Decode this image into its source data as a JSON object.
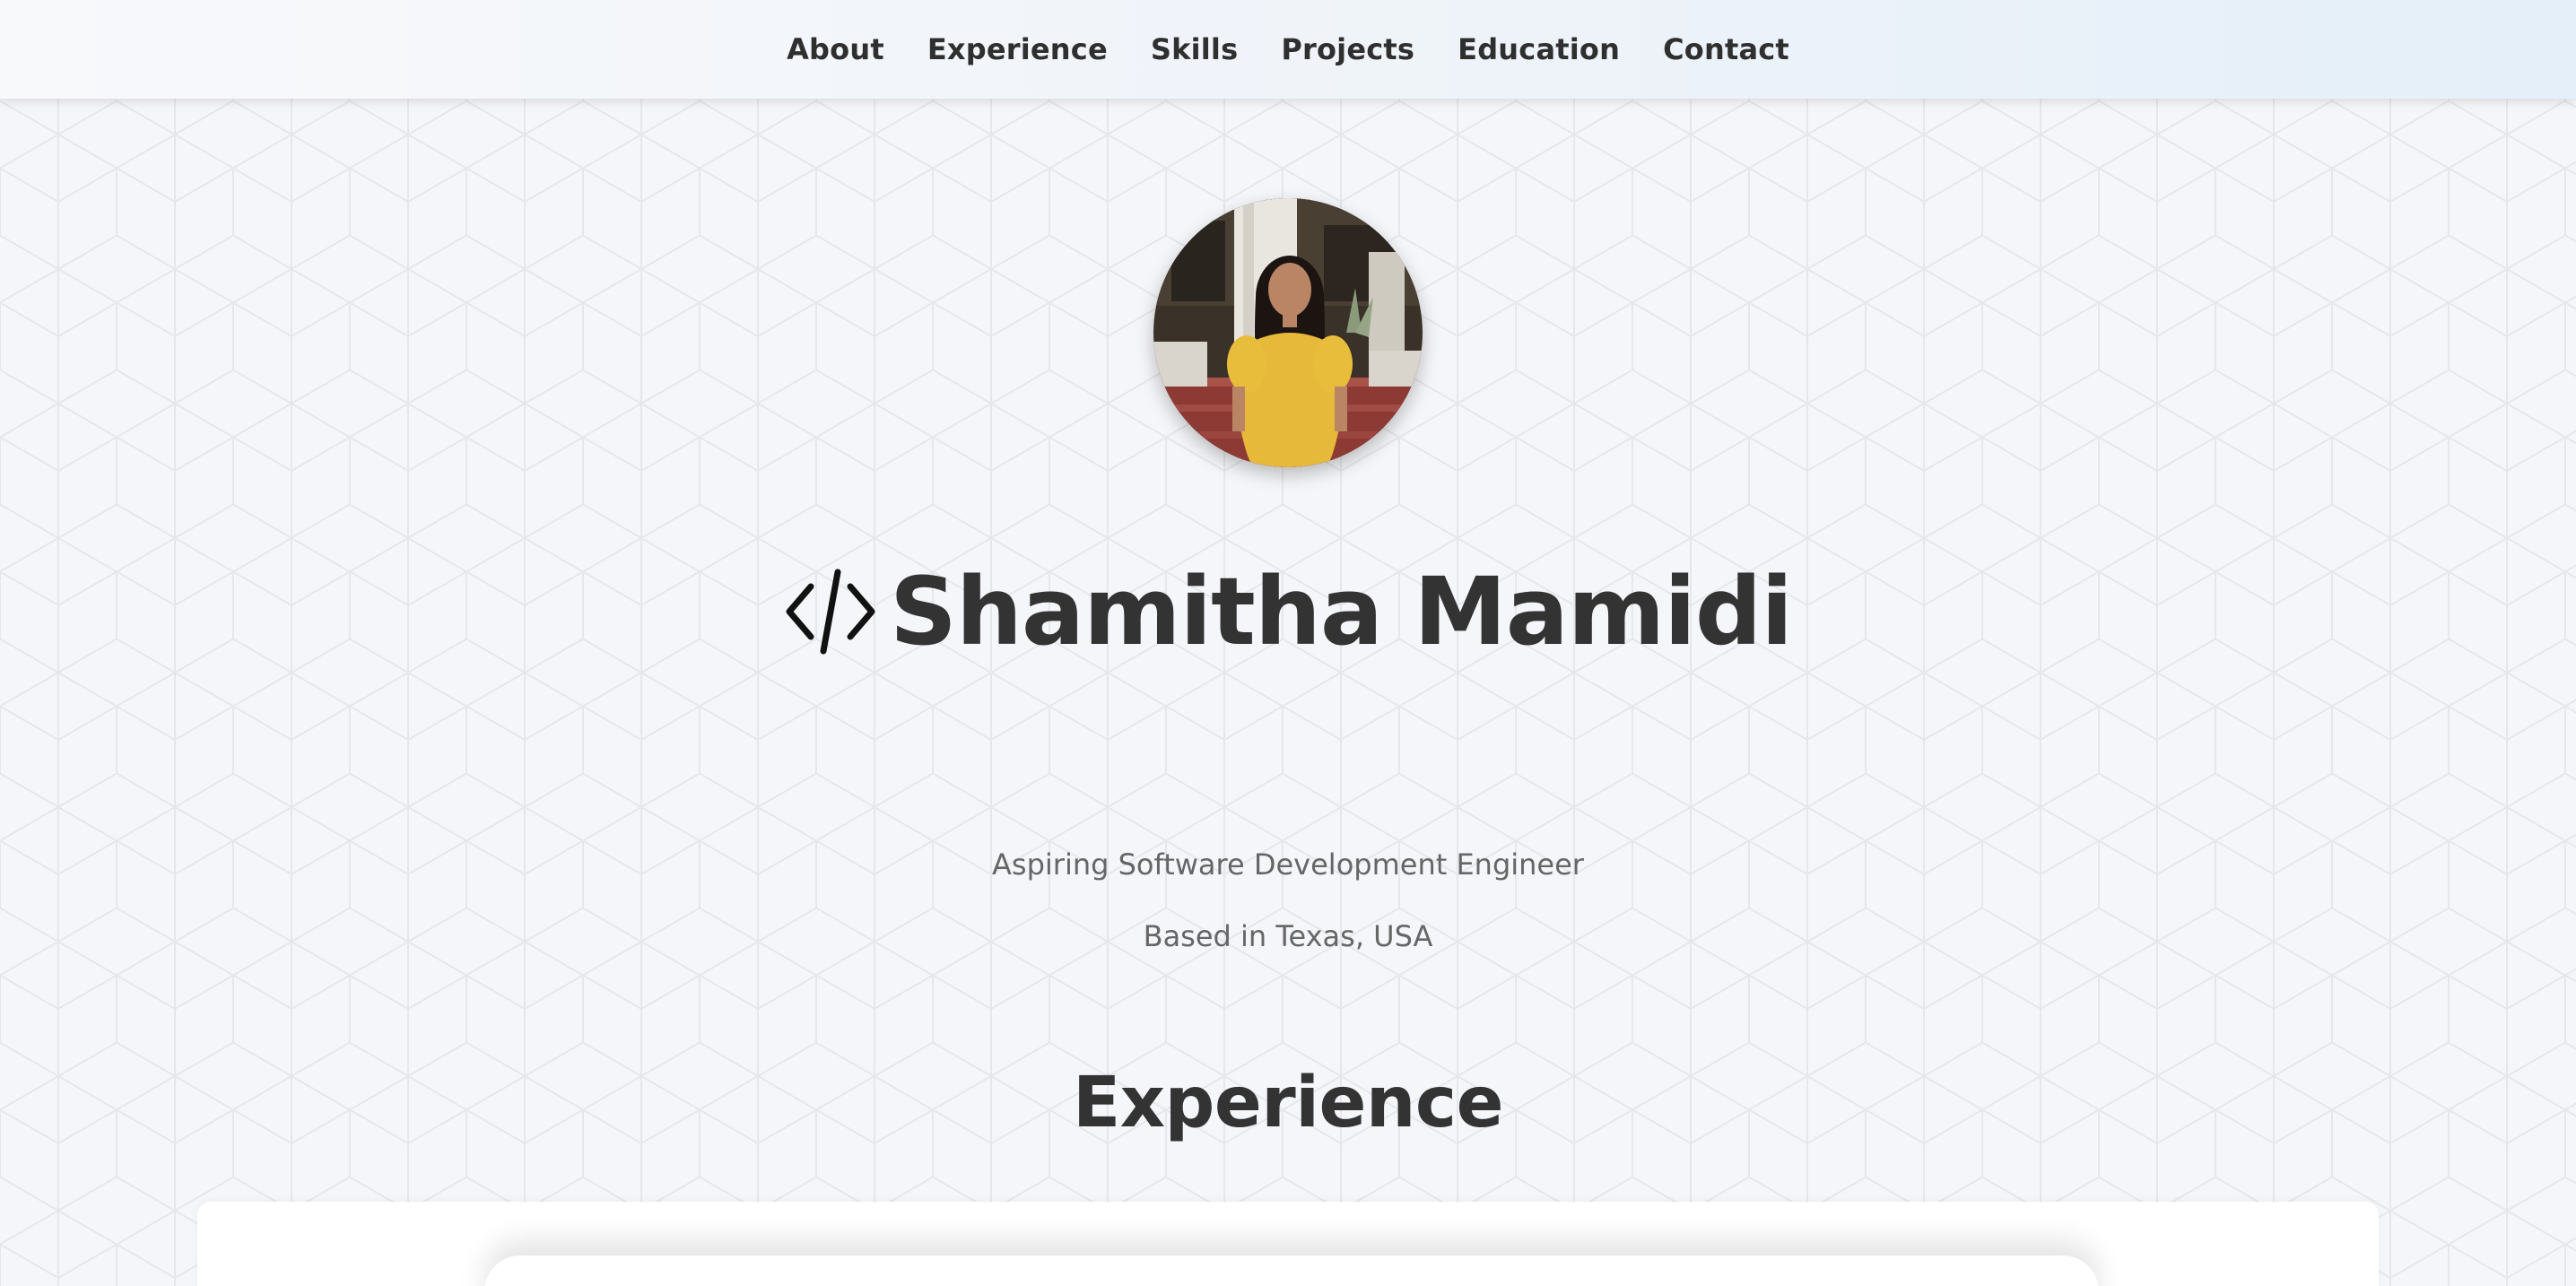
{
  "nav": {
    "items": [
      {
        "label": "About"
      },
      {
        "label": "Experience"
      },
      {
        "label": "Skills"
      },
      {
        "label": "Projects"
      },
      {
        "label": "Education"
      },
      {
        "label": "Contact"
      }
    ]
  },
  "hero": {
    "name": "Shamitha Mamidi",
    "tagline": "Aspiring Software Development Engineer",
    "location": "Based in Texas, USA",
    "icon": "code-brackets-icon"
  },
  "sections": {
    "experience_heading": "Experience"
  },
  "colors": {
    "text_dark": "#333333",
    "text_muted": "#666666",
    "background": "#f5f6f9",
    "nav_gradient_end": "#e4eff9"
  }
}
